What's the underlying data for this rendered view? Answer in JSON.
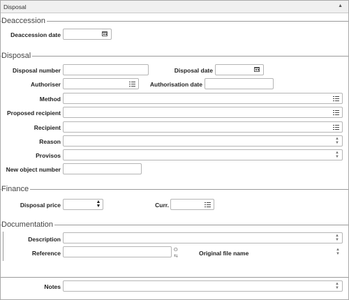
{
  "panel": {
    "title": "Disposal"
  },
  "sections": {
    "deaccession": "Deaccession",
    "disposal": "Disposal",
    "finance": "Finance",
    "documentation": "Documentation"
  },
  "fields": {
    "deaccession_date": {
      "label": "Deaccession date",
      "value": ""
    },
    "disposal_number": {
      "label": "Disposal number",
      "value": ""
    },
    "disposal_date": {
      "label": "Disposal date",
      "value": ""
    },
    "authoriser": {
      "label": "Authoriser",
      "value": ""
    },
    "authorisation_date": {
      "label": "Authorisation date",
      "value": ""
    },
    "method": {
      "label": "Method",
      "value": ""
    },
    "proposed_recipient": {
      "label": "Proposed recipient",
      "value": ""
    },
    "recipient": {
      "label": "Recipient",
      "value": ""
    },
    "reason": {
      "label": "Reason",
      "value": ""
    },
    "provisos": {
      "label": "Provisos",
      "value": ""
    },
    "new_object_number": {
      "label": "New object number",
      "value": ""
    },
    "disposal_price": {
      "label": "Disposal price",
      "value": ""
    },
    "currency": {
      "label": "Curr.",
      "value": ""
    },
    "description": {
      "label": "Description",
      "value": ""
    },
    "reference": {
      "label": "Reference",
      "value": ""
    },
    "original_file_name": {
      "label": "Original file name",
      "value": ""
    },
    "notes": {
      "label": "Notes",
      "value": ""
    }
  },
  "icons": {
    "calendar": "calendar-icon",
    "list": "list-icon",
    "spinner": "up-down-arrows-icon",
    "link": "link-icon",
    "collapse": "triangle-up-icon"
  }
}
